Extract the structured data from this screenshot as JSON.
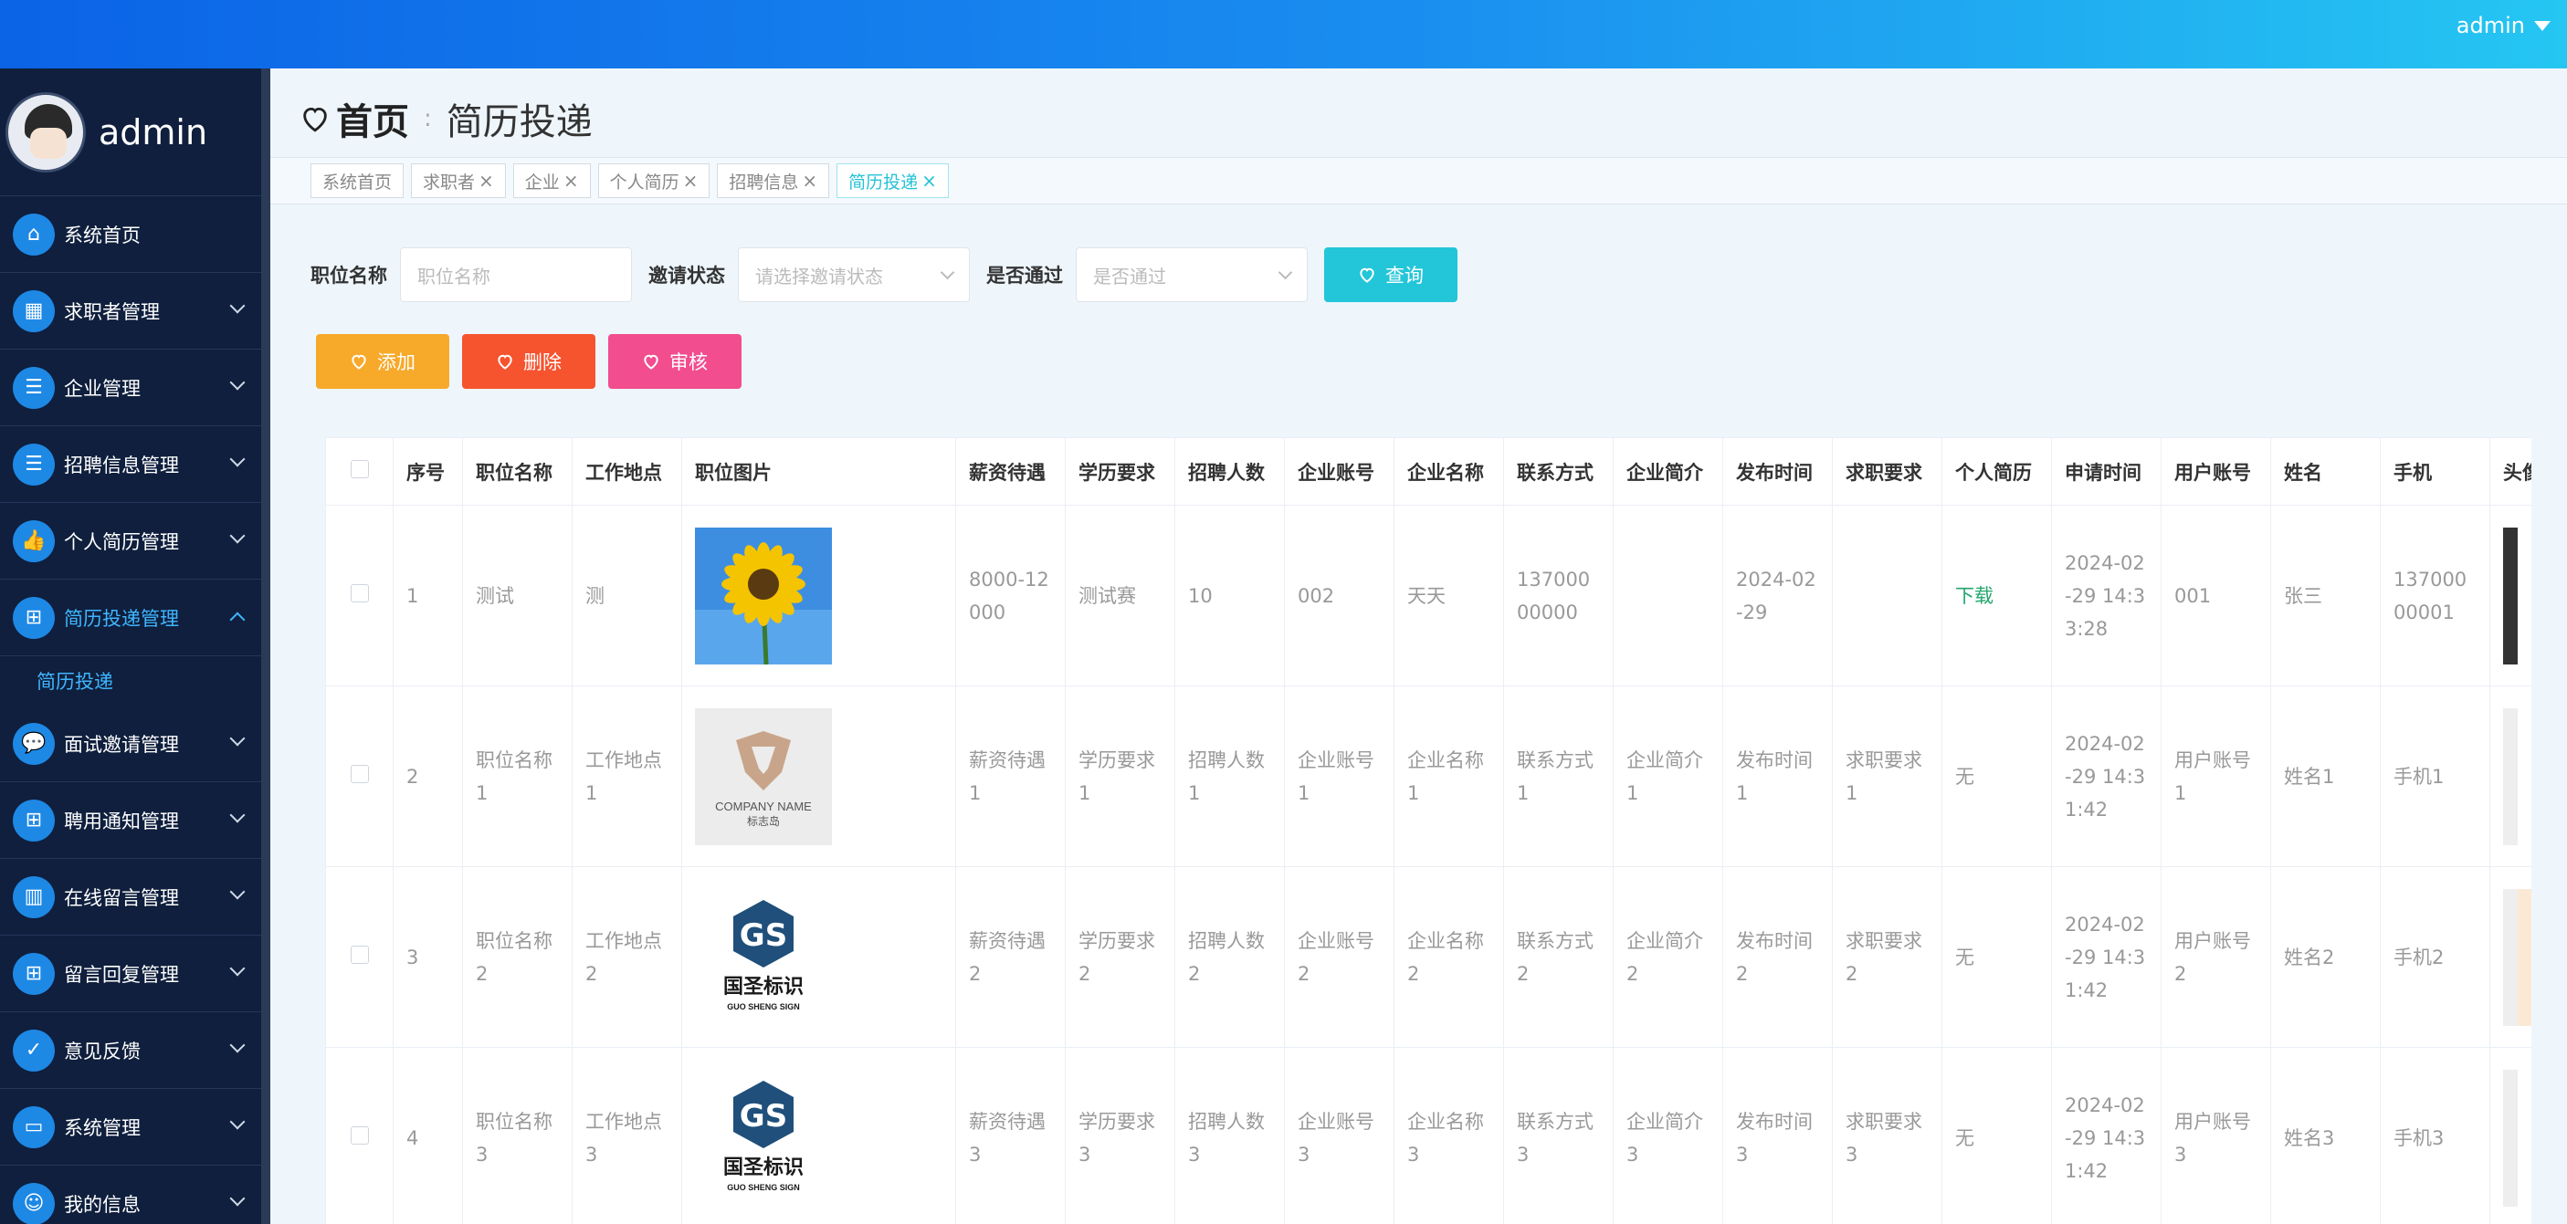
{
  "topbar": {
    "user": "admin"
  },
  "sidebar": {
    "user": "admin",
    "items": [
      {
        "label": "系统首页",
        "icon": "home-icon",
        "arrow": false
      },
      {
        "label": "求职者管理",
        "icon": "grid-icon",
        "arrow": true
      },
      {
        "label": "企业管理",
        "icon": "list-icon",
        "arrow": true
      },
      {
        "label": "招聘信息管理",
        "icon": "list-icon",
        "arrow": true
      },
      {
        "label": "个人简历管理",
        "icon": "thumb-icon",
        "arrow": true
      },
      {
        "label": "简历投递管理",
        "icon": "apps-icon",
        "arrow": true,
        "active": true,
        "sub": "简历投递"
      },
      {
        "label": "面试邀请管理",
        "icon": "chat-icon",
        "arrow": true
      },
      {
        "label": "聘用通知管理",
        "icon": "apps-icon",
        "arrow": true
      },
      {
        "label": "在线留言管理",
        "icon": "book-icon",
        "arrow": true
      },
      {
        "label": "留言回复管理",
        "icon": "apps-icon",
        "arrow": true
      },
      {
        "label": "意见反馈",
        "icon": "clipboard-icon",
        "arrow": true
      },
      {
        "label": "系统管理",
        "icon": "monitor-icon",
        "arrow": true
      },
      {
        "label": "我的信息",
        "icon": "user-icon",
        "arrow": true
      }
    ]
  },
  "page": {
    "home": "首页",
    "separator": ":",
    "current": "简历投递"
  },
  "tags": [
    {
      "label": "系统首页",
      "closable": false
    },
    {
      "label": "求职者",
      "closable": true
    },
    {
      "label": "企业",
      "closable": true
    },
    {
      "label": "个人简历",
      "closable": true
    },
    {
      "label": "招聘信息",
      "closable": true
    },
    {
      "label": "简历投递",
      "closable": true,
      "active": true
    }
  ],
  "search": {
    "job_label": "职位名称",
    "job_placeholder": "职位名称",
    "invite_label": "邀请状态",
    "invite_placeholder": "请选择邀请状态",
    "pass_label": "是否通过",
    "pass_placeholder": "是否通过",
    "query": "查询"
  },
  "actions": {
    "add": "添加",
    "delete": "删除",
    "audit": "审核"
  },
  "table": {
    "headers": [
      "序号",
      "职位名称",
      "工作地点",
      "职位图片",
      "薪资待遇",
      "学历要求",
      "招聘人数",
      "企业账号",
      "企业名称",
      "联系方式",
      "企业简介",
      "发布时间",
      "求职要求",
      "个人简历",
      "申请时间",
      "用户账号",
      "姓名",
      "手机",
      "头像"
    ],
    "rows": [
      {
        "seq": "1",
        "job": "测试",
        "place": "测",
        "img": "sunflower",
        "salary": "8000-12000",
        "edu": "测试赛",
        "count": "10",
        "account": "002",
        "company": "天天",
        "contact": "13700000000",
        "intro": "",
        "pubtime": "2024-02-29",
        "req": "",
        "resume": "下载",
        "resume_link": true,
        "apply": "2024-02-29 14:33:28",
        "user": "001",
        "name": "张三",
        "phone": "13700000001"
      },
      {
        "seq": "2",
        "job": "职位名称1",
        "place": "工作地点1",
        "img": "company",
        "salary": "薪资待遇1",
        "edu": "学历要求1",
        "count": "招聘人数1",
        "account": "企业账号1",
        "company": "企业名称1",
        "contact": "联系方式1",
        "intro": "企业简介1",
        "pubtime": "发布时间1",
        "req": "求职要求1",
        "resume": "无",
        "resume_link": false,
        "apply": "2024-02-29 14:31:42",
        "user": "用户账号1",
        "name": "姓名1",
        "phone": "手机1"
      },
      {
        "seq": "3",
        "job": "职位名称2",
        "place": "工作地点2",
        "img": "gs",
        "salary": "薪资待遇2",
        "edu": "学历要求2",
        "count": "招聘人数2",
        "account": "企业账号2",
        "company": "企业名称2",
        "contact": "联系方式2",
        "intro": "企业简介2",
        "pubtime": "发布时间2",
        "req": "求职要求2",
        "resume": "无",
        "resume_link": false,
        "apply": "2024-02-29 14:31:42",
        "user": "用户账号2",
        "name": "姓名2",
        "phone": "手机2"
      },
      {
        "seq": "4",
        "job": "职位名称3",
        "place": "工作地点3",
        "img": "gs",
        "salary": "薪资待遇3",
        "edu": "学历要求3",
        "count": "招聘人数3",
        "account": "企业账号3",
        "company": "企业名称3",
        "contact": "联系方式3",
        "intro": "企业简介3",
        "pubtime": "发布时间3",
        "req": "求职要求3",
        "resume": "无",
        "resume_link": false,
        "apply": "2024-02-29 14:31:42",
        "user": "用户账号3",
        "name": "姓名3",
        "phone": "手机3"
      }
    ]
  },
  "logos": {
    "company_line1": "COMPANY NAME",
    "company_line2": "标志岛",
    "gs_line1": "国圣标识",
    "gs_line2": "GUO SHENG SIGN"
  }
}
